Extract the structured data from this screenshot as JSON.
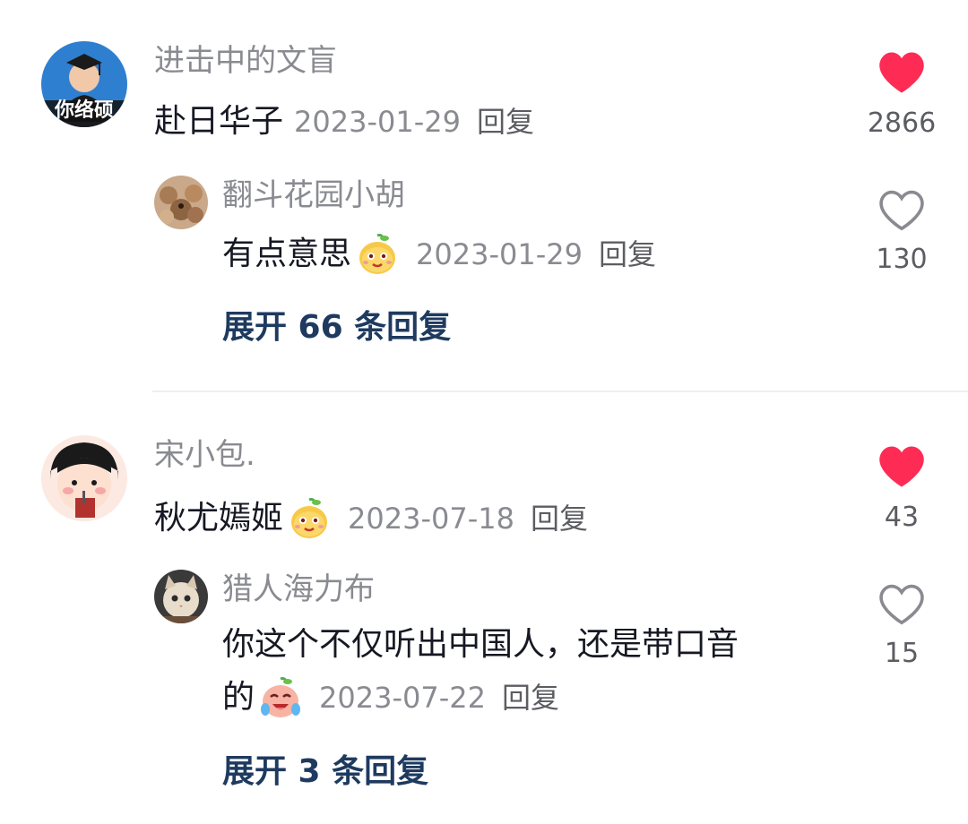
{
  "comments": [
    {
      "username": "进击中的文盲",
      "text": "赴日华子",
      "date": "2023-01-29",
      "reply_label": "回复",
      "likes": "2866",
      "liked": true,
      "avatar_text": "你络硕",
      "replies": [
        {
          "username": "翻斗花园小胡",
          "text": "有点意思",
          "date": "2023-01-29",
          "reply_label": "回复",
          "likes": "130",
          "liked": false
        }
      ],
      "expand_label": "展开 66 条回复"
    },
    {
      "username": "宋小包.",
      "text": "秋尤嫣姬",
      "date": "2023-07-18",
      "reply_label": "回复",
      "likes": "43",
      "liked": true,
      "replies": [
        {
          "username": "猎人海力布",
          "text_line1": "你这个不仅听出中国人，还是带口音",
          "text_line2": "的",
          "date": "2023-07-22",
          "reply_label": "回复",
          "likes": "15",
          "liked": false
        }
      ],
      "expand_label": "展开 3 条回复"
    }
  ],
  "colors": {
    "like_active": "#fe2c55",
    "like_inactive": "#8a8b91",
    "username": "#8a8b91",
    "expand": "#1e3a5f"
  },
  "icons": {
    "liked": "heart-filled-icon",
    "unliked": "heart-outline-icon",
    "emoji_smirk": "smirk-emoji-icon",
    "emoji_laugh_cry": "laugh-cry-emoji-icon"
  }
}
